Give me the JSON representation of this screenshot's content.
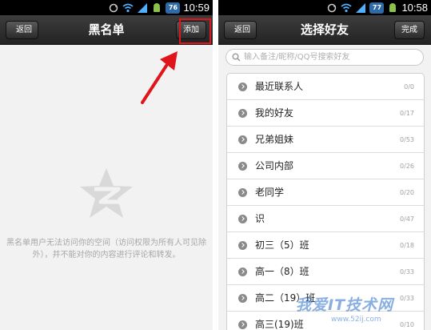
{
  "left_screen": {
    "status_bar": {
      "battery": "76",
      "time": "10:59"
    },
    "title": "黑名单",
    "back_label": "返回",
    "add_label": "添加",
    "empty_text_line1": "黑名单用户无法访问你的空间（访问权限为所有人可见除",
    "empty_text_line2": "外），并不能对你的内容进行评论和转发。"
  },
  "right_screen": {
    "status_bar": {
      "battery": "77",
      "time": "10:58"
    },
    "title": "选择好友",
    "back_label": "返回",
    "done_label": "完成",
    "search": {
      "placeholder": "输入备注/昵称/QQ号搜索好友"
    },
    "groups": [
      {
        "name": "最近联系人",
        "count": "0/0"
      },
      {
        "name": "我的好友",
        "count": "0/17"
      },
      {
        "name": "兄弟姐妹",
        "count": "0/53"
      },
      {
        "name": "公司内部",
        "count": "0/26"
      },
      {
        "name": "老同学",
        "count": "0/20"
      },
      {
        "name": "识",
        "count": "0/47"
      },
      {
        "name": "初三（5）班",
        "count": "0/18"
      },
      {
        "name": "高一（8）班",
        "count": "0/33"
      },
      {
        "name": "高二（19）班",
        "count": "0/33"
      },
      {
        "name": "高三(19)班",
        "count": "0/10"
      }
    ]
  },
  "watermark": {
    "main": "我爱IT技术网",
    "sub": "www.52ij.com"
  },
  "colors": {
    "highlight": "#e0151b",
    "titlebar": "#2a2a2a",
    "watermark": "#286ec8"
  }
}
